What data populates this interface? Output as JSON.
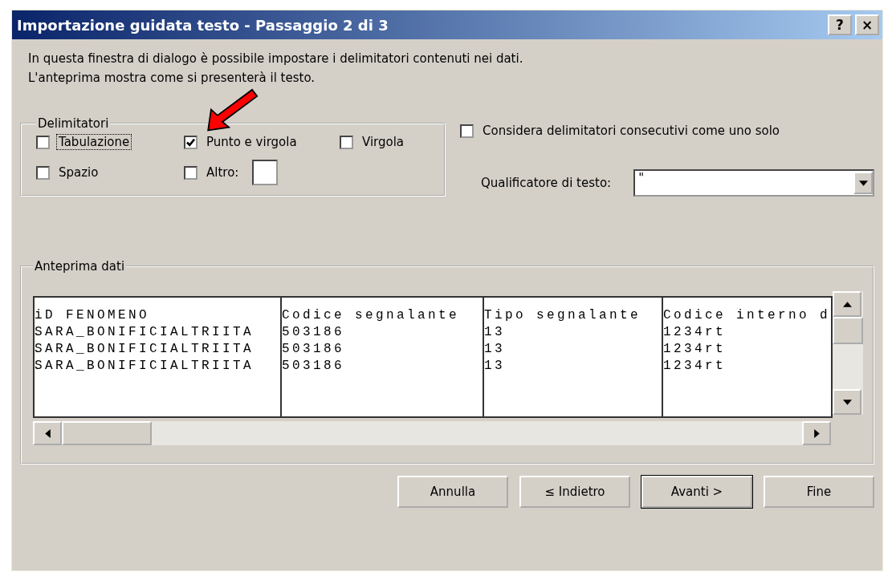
{
  "window": {
    "title": "Importazione guidata testo - Passaggio 2 di 3",
    "title_buttons": [
      "?",
      "×"
    ]
  },
  "description": [
    "In questa finestra di dialogo è possibile impostare i delimitatori contenuti nei dati.",
    "L'anteprima mostra come si presenterà il testo."
  ],
  "delimiters": {
    "legend": "Delimitatori",
    "options": [
      {
        "kind": "checkbox",
        "label": "Tabulazione",
        "checked": false,
        "focused": true
      },
      {
        "kind": "checkbox",
        "label": "Punto e virgola",
        "checked": true,
        "focused": false
      },
      {
        "kind": "checkbox",
        "label": "Virgola",
        "checked": false,
        "focused": false
      },
      {
        "kind": "checkbox",
        "label": "Spazio",
        "checked": false,
        "focused": false
      },
      {
        "kind": "other",
        "label": "Altro:",
        "checked": false,
        "focused": false
      }
    ]
  },
  "consecutive": {
    "label": "Considera delimitatori consecutivi come uno solo",
    "checked": false
  },
  "text_qualifier": {
    "label": "Qualificatore di testo:",
    "value": "\""
  },
  "preview": {
    "legend": "Anteprima dati",
    "rows": [
      [
        "iD FENOMENO",
        "Codice segnalante",
        "Tipo segnalante",
        "Codice interno d"
      ],
      [
        "SARA_BONIFICIALTRIITA",
        "503186",
        "13",
        "1234rt"
      ],
      [
        "SARA_BONIFICIALTRIITA",
        "503186",
        "13",
        "1234rt"
      ],
      [
        "SARA_BONIFICIALTRIITA",
        "503186",
        "13",
        "1234rt"
      ]
    ]
  },
  "buttons": [
    {
      "label": "Annulla",
      "default": false
    },
    {
      "label": "≤ Indietro",
      "default": false
    },
    {
      "label": "Avanti >",
      "default": true
    },
    {
      "label": "Fine",
      "default": false
    }
  ]
}
